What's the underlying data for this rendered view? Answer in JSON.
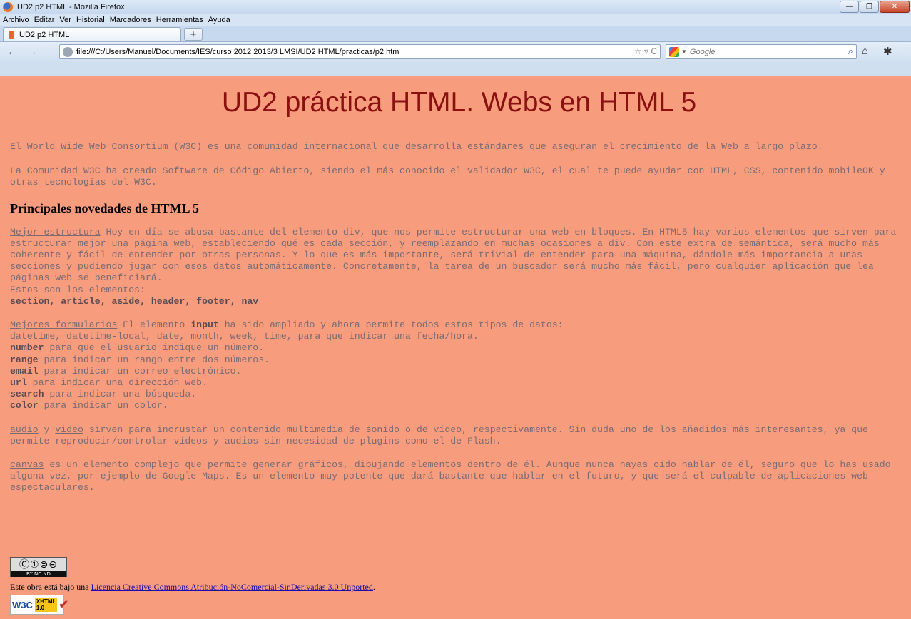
{
  "window": {
    "title": "UD2 p2 HTML - Mozilla Firefox"
  },
  "menubar": {
    "items": [
      "Archivo",
      "Editar",
      "Ver",
      "Historial",
      "Marcadores",
      "Herramientas",
      "Ayuda"
    ]
  },
  "tabs": [
    {
      "label": "UD2 p2 HTML"
    }
  ],
  "newtab_label": "+",
  "navbar": {
    "back_glyph": "←",
    "forward_glyph": "→",
    "url": "file:///C:/Users/Manuel/Documents/IES/curso 2012 2013/3 LMSI/UD2 HTML/practicas/p2.htm",
    "url_tools": "☆ ▿ C",
    "search_placeholder": "Google",
    "search_go_glyph": "⌕",
    "home_glyph": "⌂",
    "addon_glyph": "✱"
  },
  "page": {
    "title": "UD2 práctica HTML. Webs en HTML 5",
    "intro1": "El World Wide Web Consortium (W3C) es una comunidad internacional que desarrolla estándares que aseguran el crecimiento de la Web a largo plazo.",
    "intro2": "La Comunidad W3C ha creado Software de Código Abierto, siendo el más conocido el validador W3C, el cual te puede ayudar con HTML, CSS, contenido mobileOK y otras tecnologías del W3C.",
    "heading": "Principales novedades de HTML 5",
    "s1": {
      "link": "Mejor estructura",
      "text": " Hoy en día se abusa bastante del elemento div, que nos permite estructurar una web en bloques. En HTML5 hay varios elementos que sirven para estructurar mejor una página web, estableciendo qué es cada sección, y reemplazando en muchas ocasiones a div. Con este extra de semántica, será mucho más coherente y fácil de entender por otras personas. Y lo que es más importante, será trivial de entender para una máquina, dándole más importancia a unas secciones y pudiendo jugar con esos datos automáticamente. Concretamente, la tarea de un buscador será mucho más fácil, pero cualquier aplicación que lea páginas web se beneficiará.",
      "elements_label": "Estos son los elementos:",
      "elements_list": "section, article, aside, header, footer, nav"
    },
    "s2": {
      "link": "Mejores formularios",
      "text_a": " El elemento ",
      "input_kw": "input",
      "text_b": " ha sido ampliado y ahora permite todos estos tipos de datos:",
      "line_dates": "datetime, datetime-local, date, month, week, time, para que indicar una fecha/hora.",
      "types": [
        {
          "kw": "number",
          "desc": " para que el usuario indique un número."
        },
        {
          "kw": "range",
          "desc": " para indicar un rango entre dos números."
        },
        {
          "kw": "email",
          "desc": " para indicar un correo electrónico."
        },
        {
          "kw": "url",
          "desc": " para indicar una dirección web."
        },
        {
          "kw": "search",
          "desc": " para indicar una búsqueda."
        },
        {
          "kw": "color",
          "desc": " para indicar un color."
        }
      ]
    },
    "s3": {
      "link_audio": "audio",
      "and": " y ",
      "link_video": "video",
      "text": " sirven para incrustar un contenido multimedia de sonido o de vídeo, respectivamente. Sin duda uno de los añadidos más interesantes, ya que permite reproducir/controlar vídeos y audios sin necesidad de plugins como el de Flash."
    },
    "s4": {
      "link": "canvas",
      "text": " es un elemento complejo que permite generar gráficos, dibujando elementos dentro de él. Aunque nunca hayas oído hablar de él, seguro que lo has usado alguna vez, por ejemplo de Google Maps. Es un elemento muy potente que dará bastante que hablar en el futuro, y que será el culpable de aplicaciones web espectaculares."
    },
    "cc_badge": {
      "symbols": "Ⓒ①⊜⊝",
      "text": "BY  NC  ND"
    },
    "license_prefix": "Este obra está bajo una ",
    "license_link": "Licencia Creative Commons Atribución-NoComercial-SinDerivadas 3.0 Unported",
    "license_suffix": ".",
    "w3c_badge": {
      "w": "W3C",
      "x1": "XHTML",
      "x2": "1.0",
      "check": "✔"
    }
  }
}
